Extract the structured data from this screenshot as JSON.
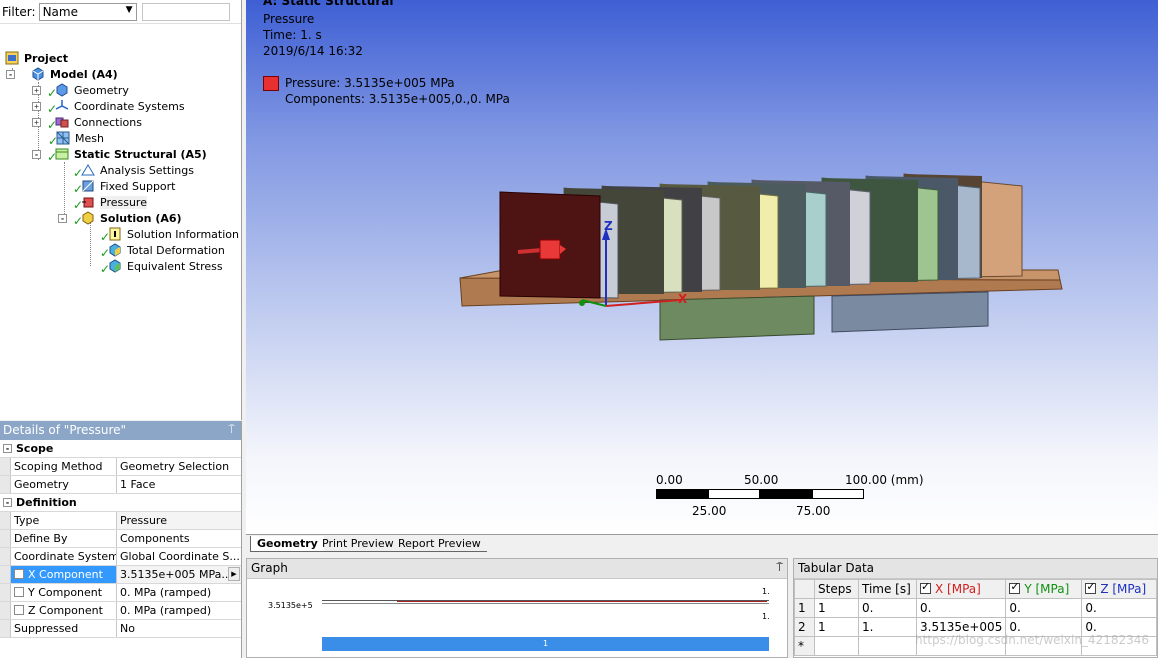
{
  "outline": {
    "filter_label": "Filter:",
    "filter_value": "Name",
    "tree": [
      {
        "label": "Project",
        "bold": true
      },
      {
        "label": "Model (A4)",
        "bold": true
      },
      {
        "label": "Geometry"
      },
      {
        "label": "Coordinate Systems"
      },
      {
        "label": "Connections"
      },
      {
        "label": "Mesh"
      },
      {
        "label": "Static Structural (A5)",
        "bold": true
      },
      {
        "label": "Analysis Settings"
      },
      {
        "label": "Fixed Support"
      },
      {
        "label": "Pressure"
      },
      {
        "label": "Solution (A6)",
        "bold": true
      },
      {
        "label": "Solution Information"
      },
      {
        "label": "Total Deformation"
      },
      {
        "label": "Equivalent Stress"
      }
    ]
  },
  "details": {
    "title": "Details of \"Pressure\"",
    "pin": "⍑",
    "groups": [
      {
        "label": "Scope",
        "rows": [
          {
            "key": "Scoping Method",
            "value": "Geometry Selection"
          },
          {
            "key": "Geometry",
            "value": "1 Face"
          }
        ]
      },
      {
        "label": "Definition",
        "rows": [
          {
            "key": "Type",
            "value": "Pressure"
          },
          {
            "key": "Define By",
            "value": "Components"
          },
          {
            "key": "Coordinate System",
            "value": "Global Coordinate S..."
          },
          {
            "key": "X Component",
            "value": "3.5135e+005 MPa..."
          },
          {
            "key": "Y Component",
            "value": "0. MPa  (ramped)"
          },
          {
            "key": "Z Component",
            "value": "0. MPa  (ramped)"
          },
          {
            "key": "Suppressed",
            "value": "No"
          }
        ]
      }
    ]
  },
  "viewport": {
    "header_title": "A: Static Structural",
    "header_lines": [
      "Pressure",
      "Time: 1. s",
      "2019/6/14 16:32"
    ],
    "legend_line1": "Pressure: 3.5135e+005 MPa",
    "legend_line2": "Components: 3.5135e+005,0.,0. MPa",
    "legend_color": "#e83030",
    "scale": {
      "t0": "0.00",
      "t50": "50.00",
      "t100": "100.00 (mm)",
      "t25": "25.00",
      "t75": "75.00"
    },
    "axes": {
      "z": "Z",
      "x": "X"
    }
  },
  "tabs": [
    "Geometry",
    "Print Preview",
    "Report Preview"
  ],
  "graph": {
    "title": "Graph",
    "y_label": "3.5135e+5",
    "right_top": "1.",
    "right_bottom": "1.",
    "timeline_label": "1"
  },
  "tabular": {
    "title": "Tabular Data",
    "headers": [
      "Steps",
      "Time [s]",
      "X [MPa]",
      "Y [MPa]",
      "Z [MPa]"
    ],
    "rows": [
      {
        "n": "1",
        "steps": "1",
        "time": "0.",
        "x": "0.",
        "y": "0.",
        "z": "0."
      },
      {
        "n": "2",
        "steps": "1",
        "time": "1.",
        "x": "3.5135e+005",
        "y": "0.",
        "z": "0."
      },
      {
        "n": "*",
        "steps": "",
        "time": "",
        "x": "",
        "y": "",
        "z": ""
      }
    ],
    "watermark": "https://blog.csdn.net/weixin_42182346"
  }
}
